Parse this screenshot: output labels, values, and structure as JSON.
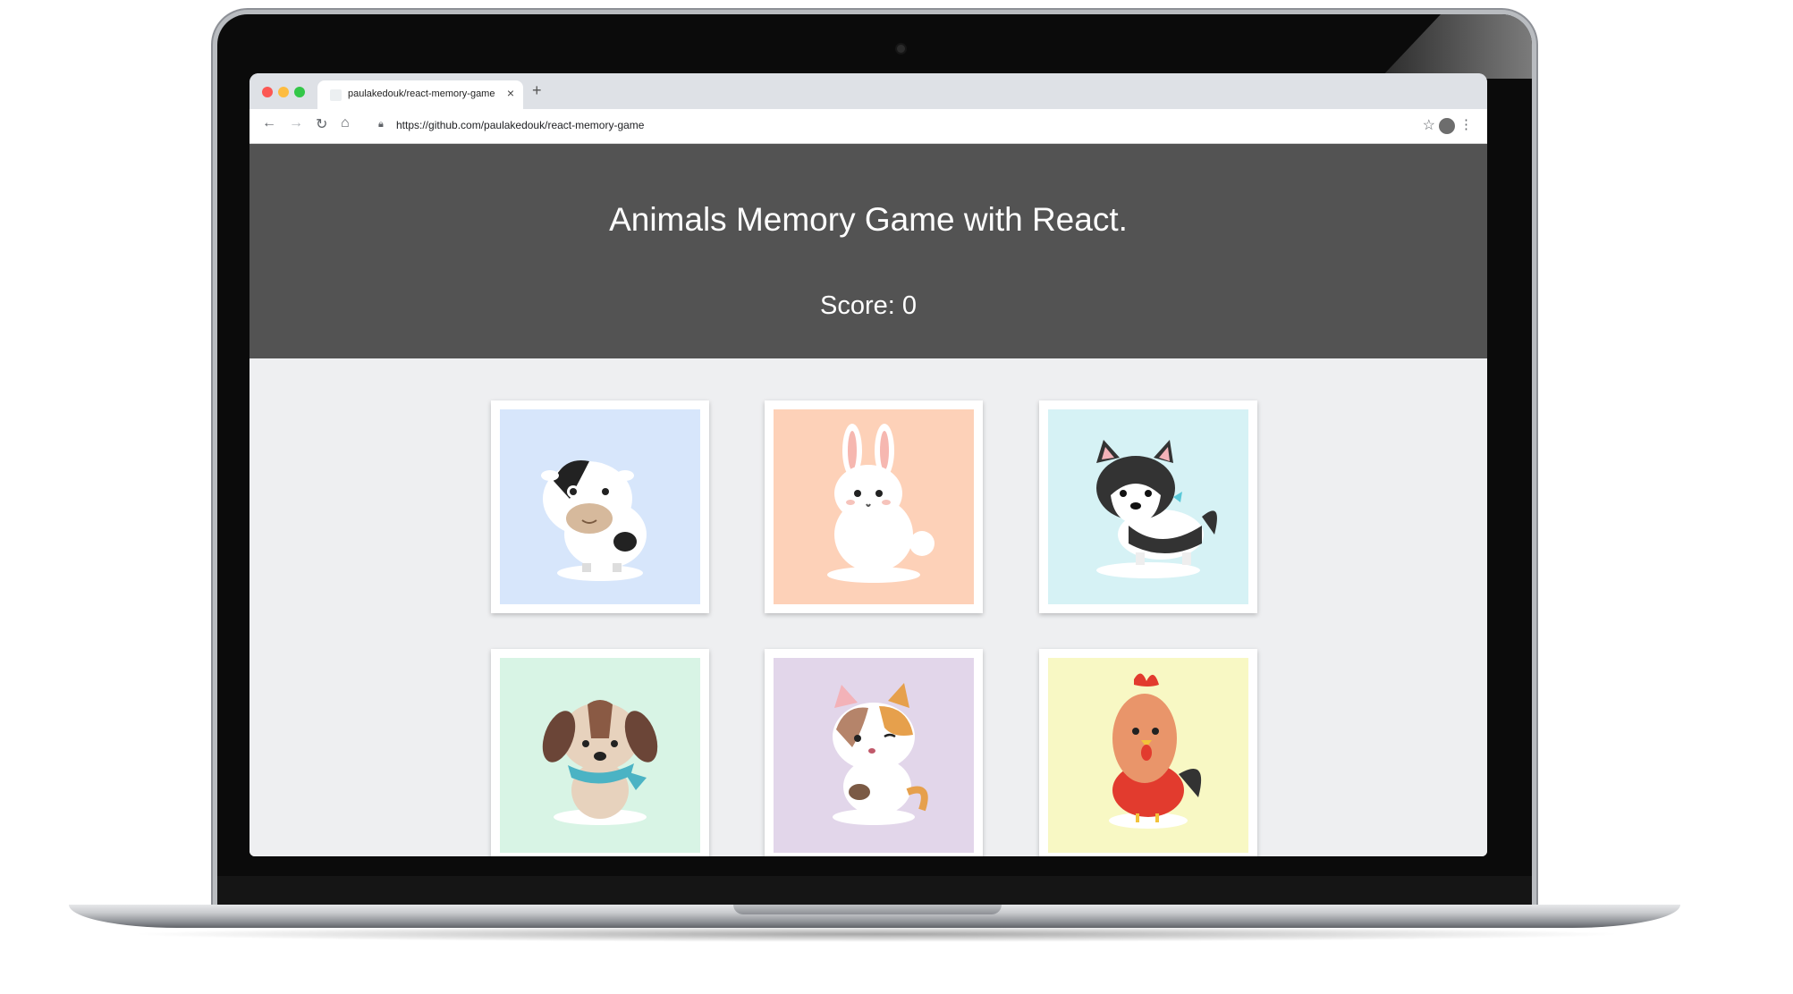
{
  "browser": {
    "tab_title": "paulakedouk/react-memory-game",
    "url": "https://github.com/paulakedouk/react-memory-game"
  },
  "app": {
    "title": "Animals Memory Game with React.",
    "score_label": "Score:",
    "score_value": "0"
  },
  "cards": [
    {
      "animal": "cow",
      "bg": "#d7e6fb"
    },
    {
      "animal": "rabbit",
      "bg": "#fdd1b8"
    },
    {
      "animal": "husky",
      "bg": "#d6f2f5"
    },
    {
      "animal": "puppy",
      "bg": "#d8f4e5"
    },
    {
      "animal": "cat",
      "bg": "#e2d6ea"
    },
    {
      "animal": "rooster",
      "bg": "#f8f8c4"
    }
  ],
  "colors": {
    "header_bg": "#535353",
    "page_bg": "#eeeff1"
  }
}
